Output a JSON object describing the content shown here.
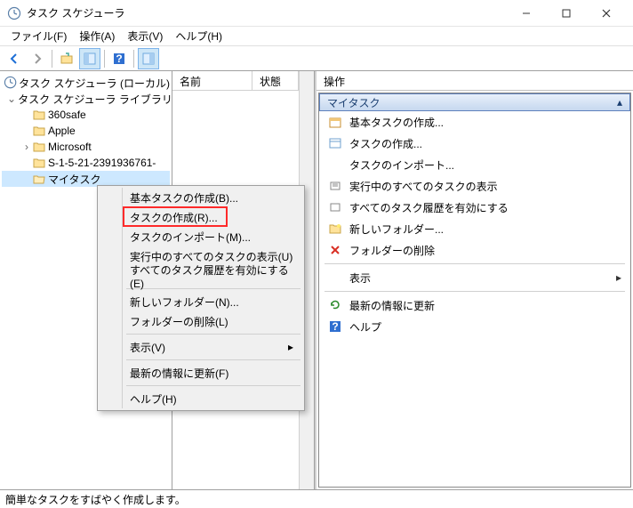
{
  "window": {
    "title": "タスク スケジューラ"
  },
  "menubar": {
    "file": "ファイル(F)",
    "action": "操作(A)",
    "view": "表示(V)",
    "help": "ヘルプ(H)"
  },
  "tree": {
    "root": "タスク スケジューラ (ローカル)",
    "library": "タスク スケジューラ ライブラリ",
    "items": [
      "360safe",
      "Apple",
      "Microsoft",
      "S-1-5-21-2391936761-",
      "マイタスク"
    ]
  },
  "list": {
    "col_name": "名前",
    "col_state": "状態"
  },
  "actions": {
    "title": "操作",
    "header": "マイタスク",
    "items": [
      "基本タスクの作成...",
      "タスクの作成...",
      "タスクのインポート...",
      "実行中のすべてのタスクの表示",
      "すべてのタスク履歴を有効にする",
      "新しいフォルダー...",
      "フォルダーの削除",
      "表示",
      "最新の情報に更新",
      "ヘルプ"
    ]
  },
  "context_menu": {
    "items": [
      "基本タスクの作成(B)...",
      "タスクの作成(R)...",
      "タスクのインポート(M)...",
      "実行中のすべてのタスクの表示(U)",
      "すべてのタスク履歴を有効にする(E)",
      "新しいフォルダー(N)...",
      "フォルダーの削除(L)",
      "表示(V)",
      "最新の情報に更新(F)",
      "ヘルプ(H)"
    ]
  },
  "statusbar": {
    "text": "簡単なタスクをすばやく作成します。"
  }
}
